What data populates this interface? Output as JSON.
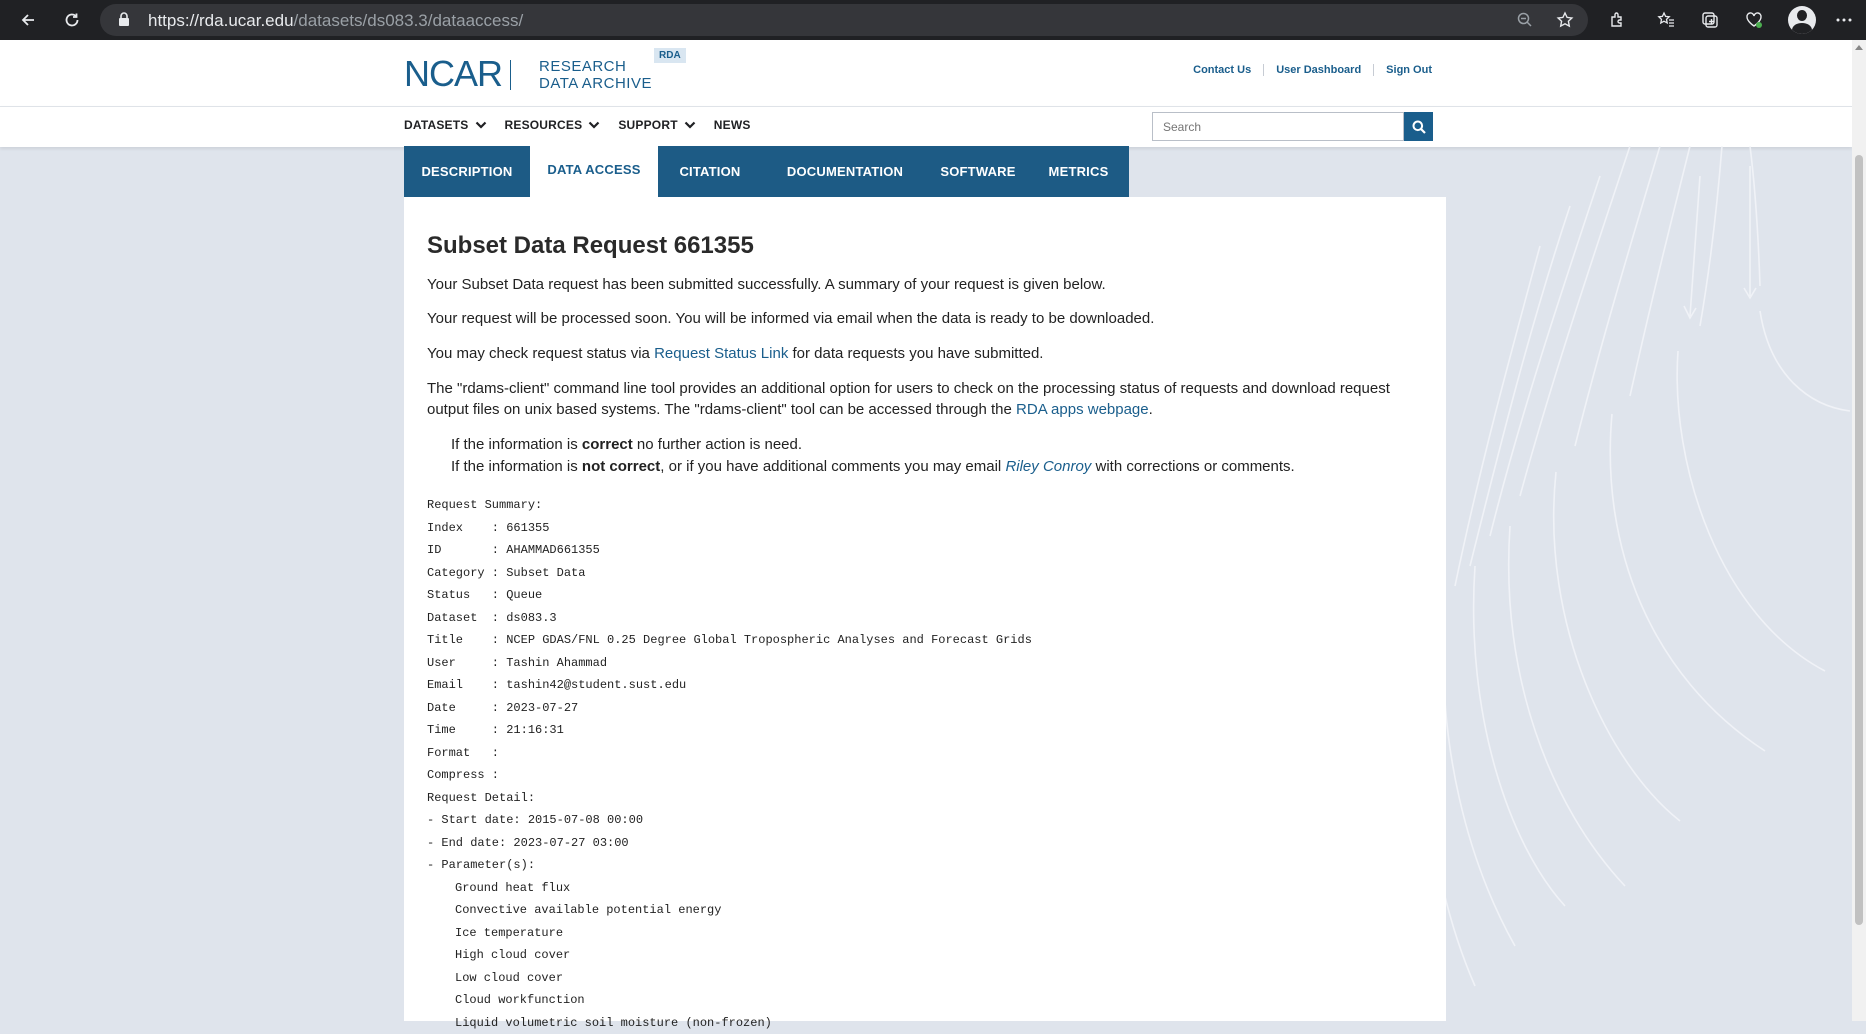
{
  "browser": {
    "url_host": "https://rda.ucar.edu",
    "url_path": "/datasets/ds083.3/dataaccess/"
  },
  "header": {
    "logo_ncar": "NCAR",
    "logo_line1": "RESEARCH",
    "logo_line2": "DATA ARCHIVE",
    "logo_badge": "RDA",
    "links": [
      "Contact Us",
      "User Dashboard",
      "Sign Out"
    ]
  },
  "menu": {
    "items": [
      "DATASETS",
      "RESOURCES",
      "SUPPORT",
      "NEWS"
    ],
    "search_placeholder": "Search"
  },
  "tabs": [
    "DESCRIPTION",
    "DATA ACCESS",
    "CITATION",
    "DOCUMENTATION",
    "SOFTWARE",
    "METRICS"
  ],
  "active_tab": "DATA ACCESS",
  "main": {
    "title": "Subset Data Request 661355",
    "p1": "Your Subset Data request has been submitted successfully. A summary of your request is given below.",
    "p2": "Your request will be processed soon. You will be informed via email when the data is ready to be downloaded.",
    "p3_before": "You may check request status via ",
    "p3_link": "Request Status Link",
    "p3_after": " for data requests you have submitted.",
    "p4_line1": "The \"rdams-client\" command line tool provides an additional option for users to check on the processing status of requests and download request",
    "p4_line2_before": "output files on unix based systems. The \"rdams-client\" tool can be accessed through the ",
    "p4_link": "RDA apps webpage",
    "p4_after": ".",
    "note1_before": "If the information is ",
    "note1_bold": "correct",
    "note1_after": " no further action is need.",
    "note2_before": "If the information is ",
    "note2_bold": "not correct",
    "note2_mid": ", or if you have additional comments you may email ",
    "note2_link": "Riley Conroy",
    "note2_after": " with corrections or comments."
  },
  "summary": {
    "lines": [
      "Request Summary:",
      "Index    : 661355",
      "ID       : AHAMMAD661355",
      "Category : Subset Data",
      "Status   : Queue",
      "Dataset  : ds083.3",
      "Title    : NCEP GDAS/FNL 0.25 Degree Global Tropospheric Analyses and Forecast Grids",
      "User     : Tashin Ahammad",
      "Email    : tashin42@student.sust.edu",
      "Date     : 2023-07-27",
      "Time     : 21:16:31",
      "Format   :",
      "Compress :",
      "Request Detail:",
      "- Start date: 2015-07-08 00:00",
      "- End date: 2023-07-27 03:00",
      "- Parameter(s):"
    ],
    "parameters": [
      "Ground heat flux",
      "Convective available potential energy",
      "Ice temperature",
      "High cloud cover",
      "Low cloud cover",
      "Cloud workfunction",
      "Liquid volumetric soil moisture (non-frozen)"
    ]
  }
}
